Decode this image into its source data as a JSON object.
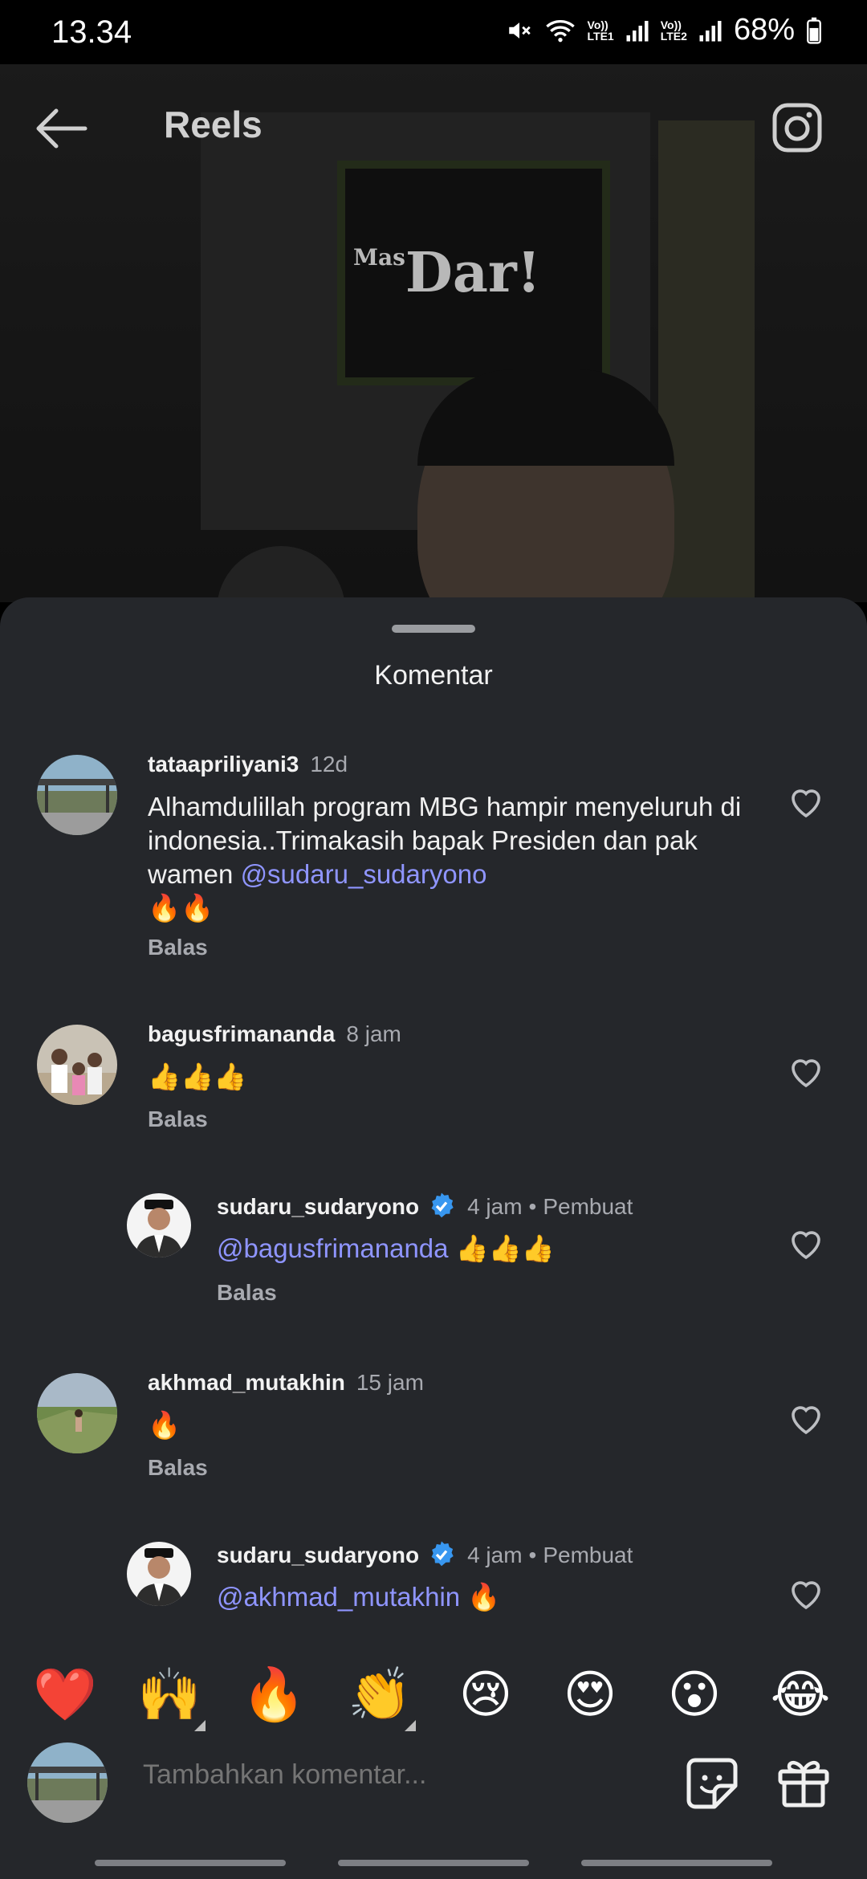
{
  "status": {
    "time": "13.34",
    "net1": "Vo))\nLTE1",
    "net2": "Vo))\nLTE2",
    "battery": "68%"
  },
  "header": {
    "title": "Reels",
    "watermark_small": "Mas",
    "watermark_big": "Dar!"
  },
  "sheet": {
    "title": "Komentar"
  },
  "comments": [
    {
      "username": "tataapriliyani3",
      "time": "12d",
      "text": "Alhamdulillah program MBG hampir menyeluruh di indonesia..Trimakasih bapak Presiden dan pak wamen ",
      "mention": "@sudaru_sudaryono",
      "emoji": "🔥🔥",
      "reply": "Balas"
    },
    {
      "username": "bagusfrimananda",
      "time": "8 jam",
      "text": "👍👍👍",
      "reply": "Balas"
    },
    {
      "username": "sudaru_sudaryono",
      "time": "4 jam",
      "creator": "Pembuat",
      "mention": "@bagusfrimananda",
      "text": " 👍👍👍",
      "reply": "Balas"
    },
    {
      "username": "akhmad_mutakhin",
      "time": "15 jam",
      "text": "🔥",
      "reply": "Balas"
    },
    {
      "username": "sudaru_sudaryono",
      "time": "4 jam",
      "creator": "Pembuat",
      "mention": "@akhmad_mutakhin",
      "text": " 🔥"
    }
  ],
  "emojis": [
    "❤️",
    "🙌",
    "🔥",
    "👏",
    "😢",
    "😍",
    "😮",
    "😂"
  ],
  "composer": {
    "placeholder": "Tambahkan komentar..."
  },
  "colors": {
    "sheet_bg": "#25272b",
    "mention": "#8f95ff",
    "verified": "#3897f0"
  }
}
